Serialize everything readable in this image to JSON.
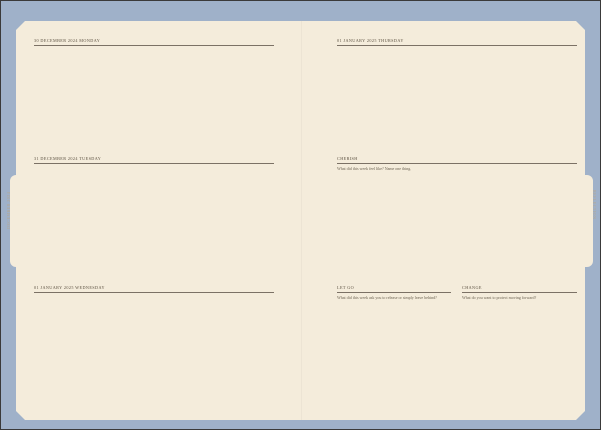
{
  "left_page": {
    "side_label": "DECEMBER 2024",
    "sections": [
      {
        "heading": "30 DECEMBER 2024 MONDAY"
      },
      {
        "heading": "31 DECEMBER 2024 TUESDAY"
      },
      {
        "heading": "01 JANUARY 2025 WEDNESDAY"
      }
    ]
  },
  "right_page": {
    "side_label": "REFLECTION",
    "sections": [
      {
        "heading": "01 JANUARY 2025 THURSDAY",
        "prompt": ""
      },
      {
        "heading": "CHERISH",
        "prompt": "What did this week feel like? Name one thing."
      },
      {
        "heading": "LET GO",
        "prompt": "What did this week ask you to release or simply leave behind?"
      },
      {
        "heading": "CHANGE",
        "prompt": "What do you want to protect moving forward?"
      }
    ]
  },
  "colors": {
    "background": "#9fb1c9",
    "paper": "#f4ecdb",
    "rule": "#7b7165",
    "heading": "#5b5040"
  }
}
